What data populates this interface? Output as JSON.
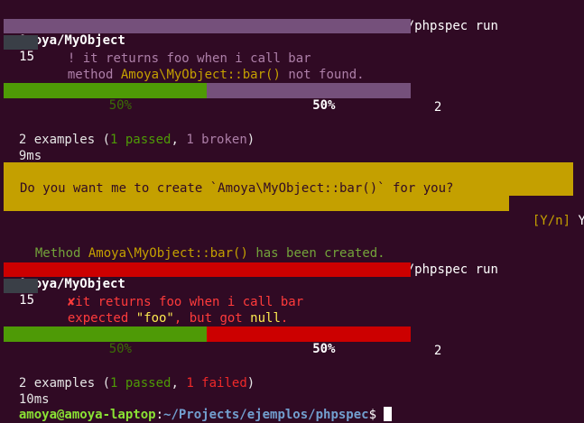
{
  "prompt": {
    "user_host": "amoya@amoya-laptop",
    "colon": ":",
    "path": "~/Projects/ejemplos/phpspec",
    "dollar": "$",
    "command": "bin/phpspec run"
  },
  "run1": {
    "spec_name": "Amoya/MyObject",
    "line_number": "15",
    "result_symbol": "!",
    "example_text": "it returns foo when i call bar",
    "message_prefix": "method ",
    "message_subject": "Amoya\\MyObject::bar()",
    "message_suffix": " not found.",
    "progress_passed_label": "50%",
    "progress_other_label": "50%",
    "progress_passed_fraction": 0.5,
    "progress_count": "2",
    "summary_prefix": "2 examples (",
    "summary_passed": "1 passed",
    "summary_sep": ", ",
    "summary_other": "1 broken",
    "summary_suffix": ")",
    "time": "9ms"
  },
  "generate_prompt": {
    "question": "Do you want me to create `Amoya\\MyObject::bar()` for you?",
    "choices": "[Y/n]",
    "answer": "Y",
    "created_prefix": "Method ",
    "created_subject": "Amoya\\MyObject::bar()",
    "created_suffix": " has been created."
  },
  "run2": {
    "spec_name": "Amoya/MyObject",
    "line_number": "15",
    "result_symbol": "✘",
    "example_text": "it returns foo when i call bar",
    "message_prefix": "expected ",
    "message_expected": "\"foo\"",
    "message_mid": ", but got ",
    "message_actual": "null",
    "message_suffix": ".",
    "progress_passed_label": "50%",
    "progress_other_label": "50%",
    "progress_passed_fraction": 0.5,
    "progress_count": "2",
    "summary_prefix": "2 examples (",
    "summary_passed": "1 passed",
    "summary_sep": ", ",
    "summary_other": "1 failed",
    "summary_suffix": ")",
    "time": "10ms"
  },
  "colors": {
    "background": "#300a24",
    "broken": "#75507b",
    "failed": "#cc0000",
    "passed": "#4e9a06",
    "prompt_box": "#c4a000"
  }
}
